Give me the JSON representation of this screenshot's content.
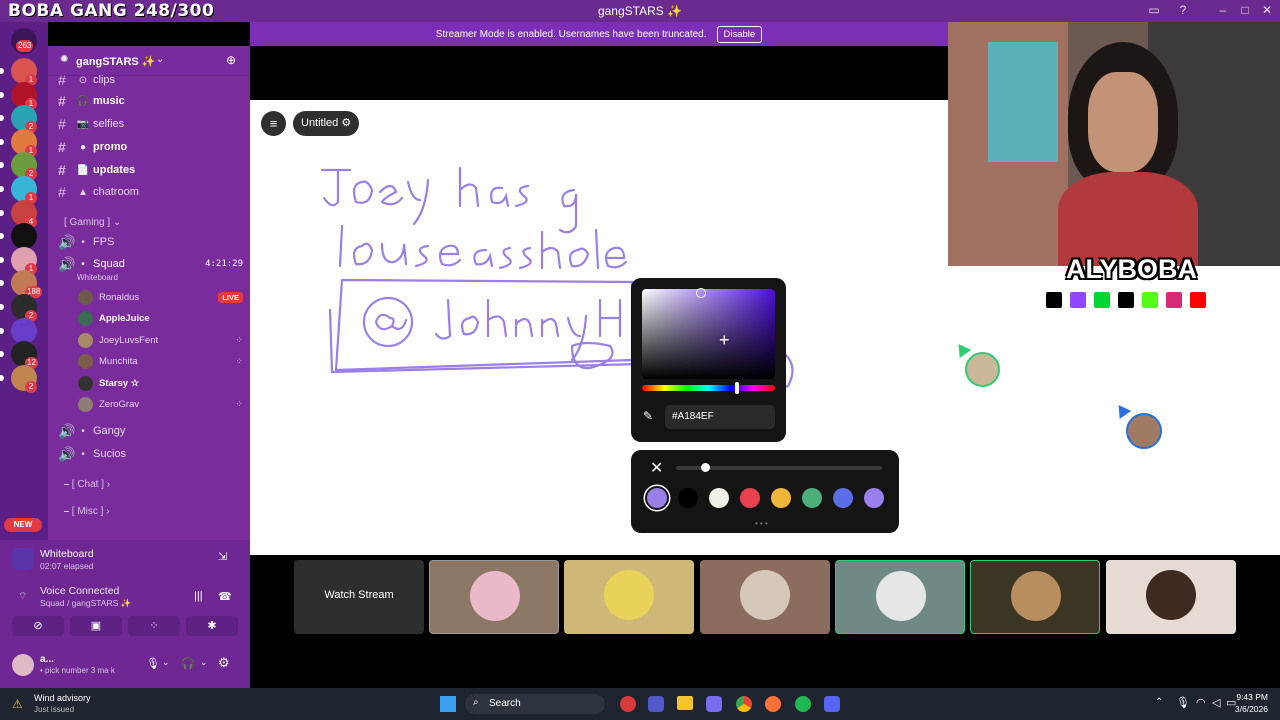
{
  "overlay": {
    "title": "BOBA GANG 248/300"
  },
  "window": {
    "title": "gangSTARS ✨"
  },
  "banner": {
    "text": "Streamer Mode is enabled. Usernames have been truncated.",
    "disable_label": "Disable"
  },
  "rail": {
    "home_badge": "263",
    "badges": [
      "1",
      "1",
      "2",
      "1",
      "2",
      "1",
      "4",
      "",
      "1",
      "188",
      "2",
      "",
      "12",
      "2"
    ],
    "new_label": "NEW"
  },
  "server": {
    "name": "gangSTARS ✨"
  },
  "channels": [
    {
      "name": "clips",
      "icon": "⊙"
    },
    {
      "name": "music",
      "icon": "🎧"
    },
    {
      "name": "selfies",
      "icon": "📷"
    },
    {
      "name": "promo",
      "icon": "●"
    },
    {
      "name": "updates",
      "icon": "📄"
    },
    {
      "name": "chatroom",
      "icon": "▲"
    }
  ],
  "categories": {
    "gaming": "[ Gaming ]",
    "chat": "[ Chat ]",
    "misc": "[ Misc ]"
  },
  "voice": [
    {
      "name": "FPS"
    },
    {
      "name": "Squad",
      "activity": "Whiteboard",
      "time": "4:21:29"
    },
    {
      "name": "Gangy"
    },
    {
      "name": "Sucios"
    }
  ],
  "users": [
    {
      "name": "Ronaldus",
      "badge": "LIVE"
    },
    {
      "name": "AppleJuice"
    },
    {
      "name": "JoeyLuvsFent"
    },
    {
      "name": "Munchita"
    },
    {
      "name": "Starsy ☆"
    },
    {
      "name": "ZeroGrav"
    }
  ],
  "activity": {
    "title": "Whiteboard",
    "elapsed": "02:07 elapsed"
  },
  "voice_status": {
    "title": "Voice Connected",
    "channel": "Squad / gangSTARS ✨"
  },
  "me": {
    "name": "a...",
    "status": "pick number 3 ma k"
  },
  "whiteboard": {
    "title": "Untitled"
  },
  "color_picker": {
    "hex": "#A184EF"
  },
  "palette": [
    "#9b7fe8",
    "#000000",
    "#f1efe6",
    "#e8424f",
    "#f0b63b",
    "#4caf7a",
    "#5b6ee8",
    "#9a7ff0"
  ],
  "tiles": {
    "watch_label": "Watch Stream"
  },
  "webcam": {
    "name": "ALYBOBA"
  },
  "notification": {
    "title": "Wind advisory",
    "sub": "Just issued"
  },
  "taskbar": {
    "search": "Search",
    "time": "9:43 PM",
    "date": "3/6/2026"
  }
}
